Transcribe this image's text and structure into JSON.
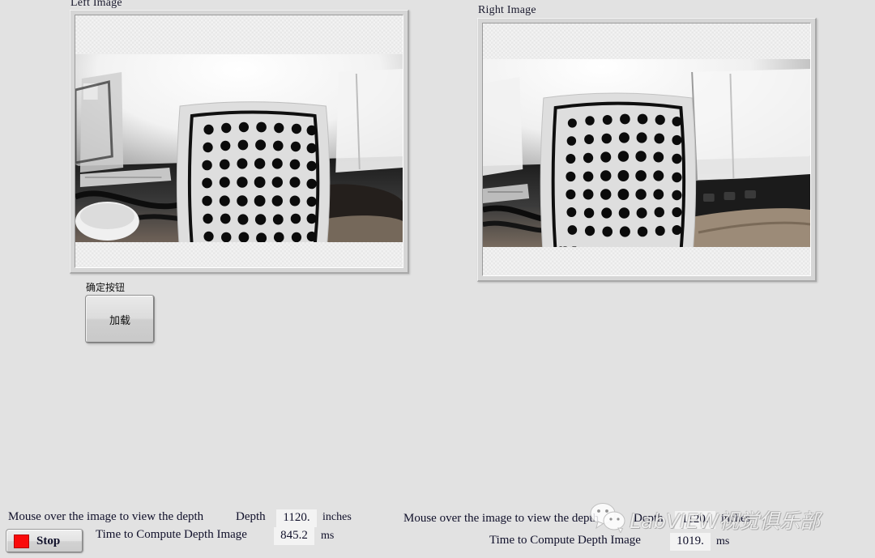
{
  "window": {
    "background_color": "#e2e2e2"
  },
  "panels": {
    "left": {
      "label": "Left Image",
      "image_alt": "Grayscale fisheye camera view of a circular-dot calibration target board (7x7 dots) on a desk"
    },
    "right": {
      "label": "Right Image",
      "image_alt": "Grayscale fisheye camera view of the same calibration target shifted left (stereo pair)"
    }
  },
  "load_control": {
    "caption": "确定按钮",
    "button_label": "加载"
  },
  "status_left": {
    "hint": "Mouse over the image to view the depth",
    "depth_label": "Depth",
    "depth_value": "1120.",
    "depth_unit": "inches",
    "time_label": "Time to Compute Depth Image",
    "time_value": "845.2",
    "time_unit": "ms"
  },
  "status_right": {
    "hint": "Mouse over the image to view the depth",
    "depth_label": "Depth",
    "depth_value": "1120.",
    "depth_unit": "inches",
    "time_label": "Time to Compute Depth Image",
    "time_value": "1019.",
    "time_unit": "ms"
  },
  "stop_button": {
    "label": "Stop",
    "led_color": "#fa0a0a"
  },
  "watermark": {
    "text": "LabVIEW视觉俱乐部",
    "icon": "wechat-icon"
  }
}
